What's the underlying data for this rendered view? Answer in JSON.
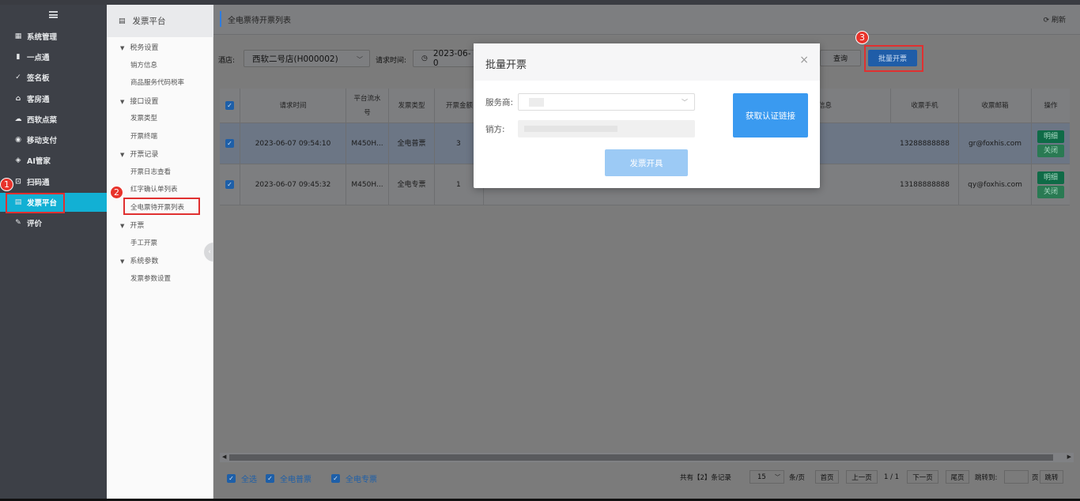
{
  "sidebar": {
    "items": [
      {
        "icon": "grid-icon",
        "glyph": "▦",
        "label": "系统管理"
      },
      {
        "icon": "bar-chart-icon",
        "glyph": "▮",
        "label": "一点通"
      },
      {
        "icon": "sign-icon",
        "glyph": "✓",
        "label": "签名板"
      },
      {
        "icon": "home-icon",
        "glyph": "⌂",
        "label": "客房通"
      },
      {
        "icon": "cloud-icon",
        "glyph": "☁",
        "label": "西软点菜"
      },
      {
        "icon": "pay-icon",
        "glyph": "◉",
        "label": "移动支付"
      },
      {
        "icon": "robot-icon",
        "glyph": "◈",
        "label": "AI管家"
      },
      {
        "icon": "scan-icon",
        "glyph": "⊡",
        "label": "扫码通"
      },
      {
        "icon": "invoice-icon",
        "glyph": "▤",
        "label": "发票平台"
      },
      {
        "icon": "edit-icon",
        "glyph": "✎",
        "label": "评价"
      }
    ]
  },
  "submenu": {
    "header": "发票平台",
    "groups": [
      {
        "label": "税务设置",
        "links": [
          "销方信息",
          "商品服务代码税率"
        ]
      },
      {
        "label": "接口设置",
        "links": [
          "发票类型",
          "开票终端"
        ]
      },
      {
        "label": "开票记录",
        "links": [
          "开票日志查看",
          "红字确认单列表",
          "全电票待开票列表"
        ]
      },
      {
        "label": "开票",
        "links": [
          "手工开票"
        ]
      },
      {
        "label": "系统参数",
        "links": [
          "发票参数设置"
        ]
      }
    ]
  },
  "main": {
    "breadcrumb": "全电票待开票列表",
    "refresh": "刷新",
    "filters": {
      "hotel_label": "酒店:",
      "hotel_value": "西软二号店(H000002)",
      "time_label": "请求时间:",
      "time_value": "2023-06-0",
      "query": "查询",
      "batch": "批量开票"
    },
    "table": {
      "headers": [
        "请求时间",
        "平台流水号",
        "发票类型",
        "开票金额",
        "信息",
        "收票手机",
        "收票邮箱",
        "操作"
      ],
      "rows": [
        {
          "time": "2023-06-07 09:54:10",
          "serial": "M450H...",
          "type": "全电普票",
          "amount": "3",
          "phone": "13288888888",
          "email": "gr@foxhis.com",
          "op1": "明细",
          "op2": "关闭"
        },
        {
          "time": "2023-06-07 09:45:32",
          "serial": "M450H...",
          "type": "全电专票",
          "amount": "1",
          "phone": "13188888888",
          "email": "qy@foxhis.com",
          "op1": "明细",
          "op2": "关闭"
        }
      ]
    },
    "footer": {
      "select_all": "全选",
      "ordinary": "全电普票",
      "special": "全电专票",
      "total": "共有【2】条记录",
      "page_size": "15",
      "per_page": "条/页",
      "first": "首页",
      "prev": "上一页",
      "page_info": "1 / 1",
      "next": "下一页",
      "last": "尾页",
      "jump_label": "跳转到:",
      "page_unit": "页",
      "jump": "跳转"
    }
  },
  "modal": {
    "title": "批量开票",
    "provider_label": "服务商:",
    "seller_label": "销方:",
    "get_link": "获取认证链接",
    "issue": "发票开具"
  },
  "badges": [
    "1",
    "2",
    "3"
  ]
}
